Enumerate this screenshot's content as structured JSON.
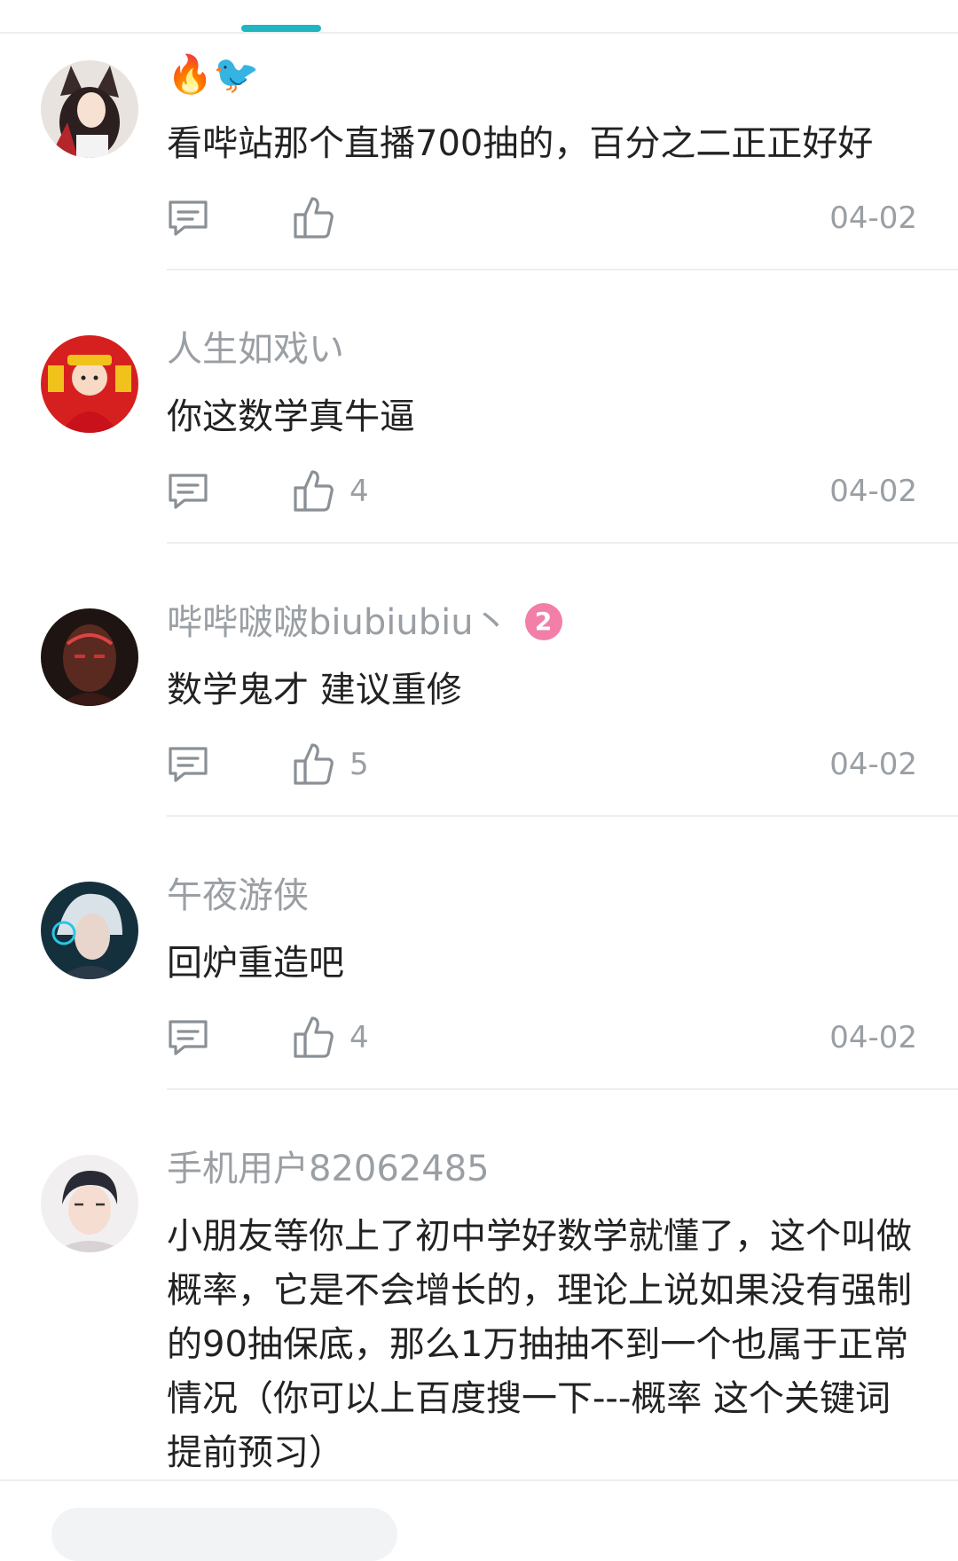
{
  "comments": [
    {
      "username": "",
      "emoji": "🔥🐦",
      "text": "看哔站那个直播700抽的，百分之二正正好好",
      "likes": "",
      "date": "04-02",
      "avatar": "fox-girl-avatar"
    },
    {
      "username": "人生如戏い",
      "text": "你这数学真牛逼",
      "likes": "4",
      "date": "04-02",
      "avatar": "god-of-wealth-avatar"
    },
    {
      "username": "哔哔啵啵biubiubiu丶",
      "badge": "2",
      "text": "数学鬼才 建议重修",
      "likes": "5",
      "date": "04-02",
      "avatar": "dark-character-avatar"
    },
    {
      "username": "午夜游侠",
      "text": "回炉重造吧",
      "likes": "4",
      "date": "04-02",
      "avatar": "silver-hair-avatar"
    },
    {
      "username": "手机用户82062485",
      "text": "小朋友等你上了初中学好数学就懂了，这个叫做概率，它是不会增长的，理论上说如果没有强制的90抽保底，那么1万抽抽不到一个也属于正常情况（你可以上百度搜一下---概率 这个关键词提前预习）",
      "likes": "",
      "date": "",
      "avatar": "anime-boy-avatar"
    }
  ],
  "colors": {
    "accent": "#1fb6c1",
    "muted_text": "#9a9fa4",
    "badge": "#f27fa7"
  },
  "icons": {
    "reply": "comment-bubble-icon",
    "like": "thumbs-up-icon"
  }
}
